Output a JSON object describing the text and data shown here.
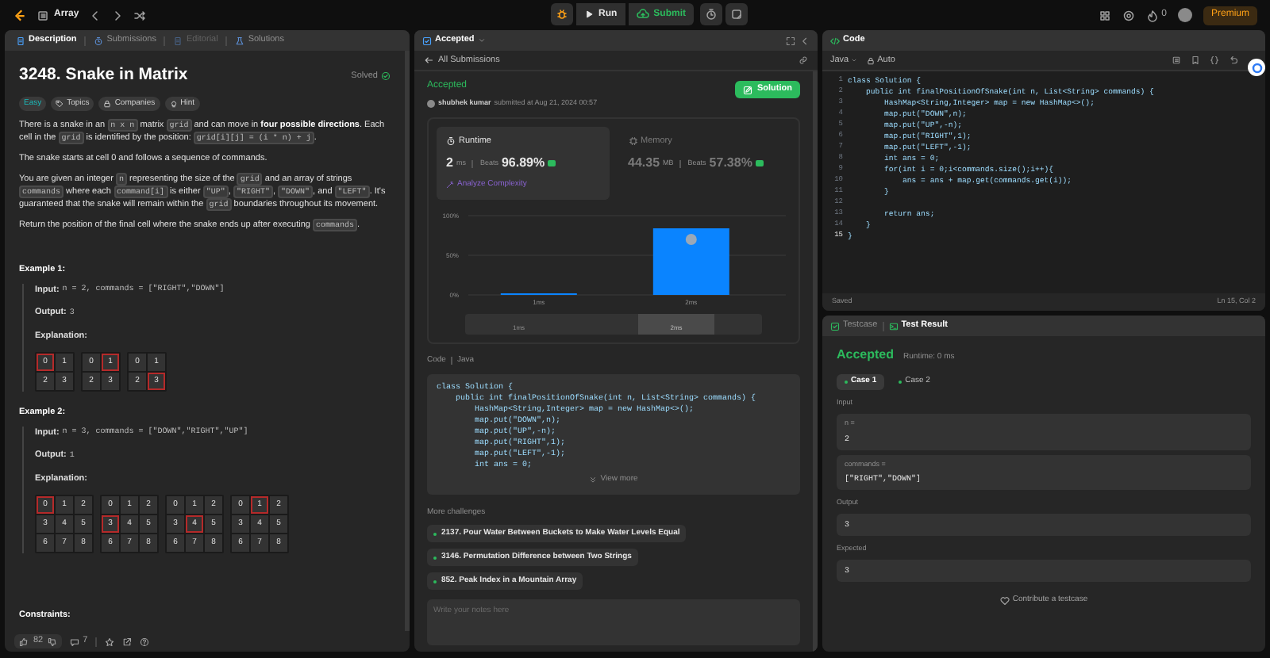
{
  "top_bar": {
    "problem_list": "Array",
    "run": "Run",
    "submit": "Submit",
    "streak": "0",
    "premium": "Premium"
  },
  "description_panel": {
    "tabs": [
      {
        "label": "Description",
        "selected": true,
        "disabled": false
      },
      {
        "label": "Submissions",
        "selected": false,
        "disabled": false
      },
      {
        "label": "Editorial",
        "selected": false,
        "disabled": true
      },
      {
        "label": "Solutions",
        "selected": false,
        "disabled": false
      }
    ],
    "title": "3248. Snake in Matrix",
    "status": "Solved",
    "tags": [
      {
        "label": "Easy",
        "kind": "difficulty"
      },
      {
        "label": "Topics",
        "kind": "tag"
      },
      {
        "label": "Companies",
        "kind": "lock"
      },
      {
        "label": "Hint",
        "kind": "hint"
      }
    ],
    "paragraphs": [
      [
        {
          "kind": "text",
          "text": "There is a snake in an "
        },
        {
          "kind": "code",
          "text": "n x n"
        },
        {
          "kind": "text",
          "text": " matrix "
        },
        {
          "kind": "code",
          "text": "grid"
        },
        {
          "kind": "text",
          "text": " and can move in "
        },
        {
          "kind": "bold",
          "text": "four possible directions"
        },
        {
          "kind": "text",
          "text": ". Each cell in the "
        },
        {
          "kind": "code",
          "text": "grid"
        },
        {
          "kind": "text",
          "text": " is identified by the position: "
        },
        {
          "kind": "code",
          "text": "grid[i][j] = (i * n) + j"
        },
        {
          "kind": "text",
          "text": "."
        }
      ],
      [
        {
          "kind": "text",
          "text": "The snake starts at cell 0 and follows a sequence of commands."
        }
      ],
      [
        {
          "kind": "text",
          "text": "You are given an integer "
        },
        {
          "kind": "code",
          "text": "n"
        },
        {
          "kind": "text",
          "text": " representing the size of the "
        },
        {
          "kind": "code",
          "text": "grid"
        },
        {
          "kind": "text",
          "text": " and an array of strings "
        },
        {
          "kind": "code",
          "text": "commands"
        },
        {
          "kind": "text",
          "text": " where each "
        },
        {
          "kind": "code",
          "text": "command[i]"
        },
        {
          "kind": "text",
          "text": " is either "
        },
        {
          "kind": "code",
          "text": "\"UP\""
        },
        {
          "kind": "text",
          "text": ", "
        },
        {
          "kind": "code",
          "text": "\"RIGHT\""
        },
        {
          "kind": "text",
          "text": ", "
        },
        {
          "kind": "code",
          "text": "\"DOWN\""
        },
        {
          "kind": "text",
          "text": ", and "
        },
        {
          "kind": "code",
          "text": "\"LEFT\""
        },
        {
          "kind": "text",
          "text": ". It's guaranteed that the snake will remain within the "
        },
        {
          "kind": "code",
          "text": "grid"
        },
        {
          "kind": "text",
          "text": " boundaries throughout its movement."
        }
      ],
      [
        {
          "kind": "text",
          "text": "Return the position of the final cell where the snake ends up after executing "
        },
        {
          "kind": "code",
          "text": "commands"
        },
        {
          "kind": "text",
          "text": "."
        }
      ]
    ],
    "examples": [
      {
        "title": "Example 1:",
        "input_label": "Input:",
        "input": "n = 2, commands = [\"RIGHT\",\"DOWN\"]",
        "output_label": "Output:",
        "output": "3",
        "explanation_label": "Explanation:",
        "grids": [
          [
            {
              "text": "0",
              "selected": true
            },
            {
              "text": "1",
              "selected": false
            },
            {
              "text": "2",
              "selected": false
            },
            {
              "text": "3",
              "selected": false
            }
          ],
          [
            {
              "text": "0",
              "selected": false
            },
            {
              "text": "1",
              "selected": true
            },
            {
              "text": "2",
              "selected": false
            },
            {
              "text": "3",
              "selected": false
            }
          ],
          [
            {
              "text": "0",
              "selected": false
            },
            {
              "text": "1",
              "selected": false
            },
            {
              "text": "2",
              "selected": false
            },
            {
              "text": "3",
              "selected": true
            }
          ]
        ]
      },
      {
        "title": "Example 2:",
        "input_label": "Input:",
        "input": "n = 3, commands = [\"DOWN\",\"RIGHT\",\"UP\"]",
        "output_label": "Output:",
        "output": "1",
        "explanation_label": "Explanation:",
        "grids": [
          [
            {
              "text": "0",
              "selected": true
            },
            {
              "text": "1",
              "selected": false
            },
            {
              "text": "2",
              "selected": false
            },
            {
              "text": "3",
              "selected": false
            },
            {
              "text": "4",
              "selected": false
            },
            {
              "text": "5",
              "selected": false
            },
            {
              "text": "6",
              "selected": false
            },
            {
              "text": "7",
              "selected": false
            },
            {
              "text": "8",
              "selected": false
            }
          ],
          [
            {
              "text": "0",
              "selected": false
            },
            {
              "text": "1",
              "selected": false
            },
            {
              "text": "2",
              "selected": false
            },
            {
              "text": "3",
              "selected": true
            },
            {
              "text": "4",
              "selected": false
            },
            {
              "text": "5",
              "selected": false
            },
            {
              "text": "6",
              "selected": false
            },
            {
              "text": "7",
              "selected": false
            },
            {
              "text": "8",
              "selected": false
            }
          ],
          [
            {
              "text": "0",
              "selected": false
            },
            {
              "text": "1",
              "selected": false
            },
            {
              "text": "2",
              "selected": false
            },
            {
              "text": "3",
              "selected": false
            },
            {
              "text": "4",
              "selected": true
            },
            {
              "text": "5",
              "selected": false
            },
            {
              "text": "6",
              "selected": false
            },
            {
              "text": "7",
              "selected": false
            },
            {
              "text": "8",
              "selected": false
            }
          ],
          [
            {
              "text": "0",
              "selected": false
            },
            {
              "text": "1",
              "selected": true
            },
            {
              "text": "2",
              "selected": false
            },
            {
              "text": "3",
              "selected": false
            },
            {
              "text": "4",
              "selected": false
            },
            {
              "text": "5",
              "selected": false
            },
            {
              "text": "6",
              "selected": false
            },
            {
              "text": "7",
              "selected": false
            },
            {
              "text": "8",
              "selected": false
            }
          ]
        ]
      }
    ],
    "constraints_title": "Constraints:",
    "footer": {
      "likes": "82",
      "comments": "7"
    }
  },
  "submission_panel": {
    "title": "Accepted",
    "back_link": "All Submissions",
    "status": "Accepted",
    "author": "shubhek kumar",
    "submitted": "submitted at Aug 21, 2024 00:57",
    "solution_button": "Solution",
    "stats": [
      {
        "kind": "runtime",
        "label": "Runtime",
        "value": "2",
        "unit": "ms",
        "beats_label": "Beats",
        "beats": "96.89%",
        "selected": true,
        "link": "Analyze Complexity"
      },
      {
        "kind": "memory",
        "label": "Memory",
        "value": "44.35",
        "unit": "MB",
        "beats_label": "Beats",
        "beats": "57.38%",
        "selected": false
      }
    ],
    "chart_data": {
      "type": "bar",
      "categories": [
        "1ms",
        "2ms"
      ],
      "values": [
        2,
        84
      ],
      "ylim": [
        0,
        100
      ],
      "yticks": [
        {
          "value": 0,
          "label": "0%"
        },
        {
          "value": 50,
          "label": "50%"
        },
        {
          "value": 100,
          "label": "100%"
        }
      ]
    },
    "range_labels": [
      "1ms",
      "2ms"
    ],
    "code_label": "Code",
    "language": "Java",
    "code_preview": [
      "class Solution {",
      "    public int finalPositionOfSnake(int n, List<String> commands) {",
      "        HashMap<String,Integer> map = new HashMap<>();",
      "        map.put(\"DOWN\",n);",
      "        map.put(\"UP\",-n);",
      "        map.put(\"RIGHT\",1);",
      "        map.put(\"LEFT\",-1);",
      "        int ans = 0;"
    ],
    "view_more": "View more",
    "more_challenges_title": "More challenges",
    "challenges": [
      "2137. Pour Water Between Buckets to Make Water Levels Equal",
      "3146. Permutation Difference between Two Strings",
      "852. Peak Index in a Mountain Array"
    ],
    "notes_placeholder": "Write your notes here"
  },
  "code_panel": {
    "title": "Code",
    "language": "Java",
    "mode": "Auto",
    "lines": [
      {
        "num": "1",
        "text": "class Solution {"
      },
      {
        "num": "2",
        "text": "    public int finalPositionOfSnake(int n, List<String> commands) {"
      },
      {
        "num": "3",
        "text": "        HashMap<String,Integer> map = new HashMap<>();"
      },
      {
        "num": "4",
        "text": "        map.put(\"DOWN\",n);"
      },
      {
        "num": "5",
        "text": "        map.put(\"UP\",-n);"
      },
      {
        "num": "6",
        "text": "        map.put(\"RIGHT\",1);"
      },
      {
        "num": "7",
        "text": "        map.put(\"LEFT\",-1);"
      },
      {
        "num": "8",
        "text": "        int ans = 0;"
      },
      {
        "num": "9",
        "text": "        for(int i = 0;i<commands.size();i++){"
      },
      {
        "num": "10",
        "text": "            ans = ans + map.get(commands.get(i));"
      },
      {
        "num": "11",
        "text": "        }"
      },
      {
        "num": "12"
      },
      {
        "num": "13",
        "text": "        return ans;"
      },
      {
        "num": "14",
        "text": "    }"
      },
      {
        "num": "15",
        "text": "}"
      }
    ],
    "status": "Saved",
    "cursor": "Ln 15, Col 2"
  },
  "test_panel": {
    "tabs": [
      {
        "label": "Testcase",
        "selected": false
      },
      {
        "label": "Test Result",
        "selected": true
      }
    ],
    "verdict": "Accepted",
    "runtime": "Runtime: 0 ms",
    "cases": [
      {
        "label": "Case 1",
        "selected": true
      },
      {
        "label": "Case 2",
        "selected": false
      }
    ],
    "input_label": "Input",
    "inputs": [
      {
        "name": "n =",
        "value": "2"
      },
      {
        "name": "commands =",
        "value": "[\"RIGHT\",\"DOWN\"]"
      }
    ],
    "output_label": "Output",
    "output": "3",
    "expected_label": "Expected",
    "expected": "3",
    "contribute": "Contribute a testcase"
  }
}
